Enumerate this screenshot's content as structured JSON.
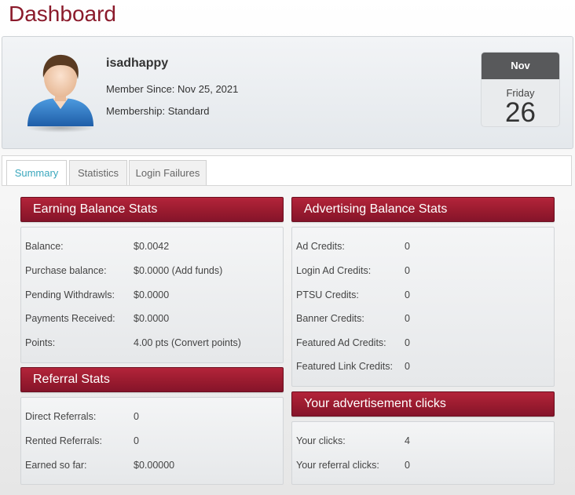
{
  "page": {
    "title": "Dashboard"
  },
  "profile": {
    "username": "isadhappy",
    "member_since": "Member Since: Nov 25, 2021",
    "membership": "Membership: Standard"
  },
  "calendar": {
    "month": "Nov",
    "weekday": "Friday",
    "day": "26"
  },
  "tabs": [
    {
      "label": "Summary",
      "active": true
    },
    {
      "label": "Statistics",
      "active": false
    },
    {
      "label": "Login Failures",
      "active": false
    }
  ],
  "earning": {
    "title": "Earning Balance Stats",
    "rows": [
      {
        "label": "Balance:",
        "value": "$0.0042"
      },
      {
        "label": "Purchase balance:",
        "value": "$0.0000",
        "link_text": "(Add funds)"
      },
      {
        "label": "Pending Withdrawls:",
        "value": "$0.0000"
      },
      {
        "label": "Payments Received:",
        "value": "$0.0000"
      },
      {
        "label": "Points:",
        "value": "4.00 pts",
        "link_text": "(Convert points)"
      }
    ]
  },
  "referral": {
    "title": "Referral Stats",
    "rows": [
      {
        "label": "Direct Referrals:",
        "value": "0"
      },
      {
        "label": "Rented Referrals:",
        "value": "0"
      },
      {
        "label": "Earned so far:",
        "value": "$0.00000"
      }
    ]
  },
  "advertising": {
    "title": "Advertising Balance Stats",
    "rows": [
      {
        "label": "Ad Credits:",
        "value": "0"
      },
      {
        "label": "Login Ad Credits:",
        "value": "0"
      },
      {
        "label": "PTSU Credits:",
        "value": "0"
      },
      {
        "label": "Banner Credits:",
        "value": "0"
      },
      {
        "label": "Featured Ad Credits:",
        "value": "0"
      },
      {
        "label": "Featured Link Credits:",
        "value": "0"
      }
    ]
  },
  "clicks": {
    "title": "Your advertisement clicks",
    "rows": [
      {
        "label": "Your clicks:",
        "value": "4"
      },
      {
        "label": "Your referral clicks:",
        "value": "0"
      }
    ]
  },
  "colors": {
    "brand": "#9a1b2f",
    "tab_active": "#3aa7bd",
    "calendar_header": "#58595b"
  },
  "icons": {
    "avatar": "user-avatar-icon"
  }
}
